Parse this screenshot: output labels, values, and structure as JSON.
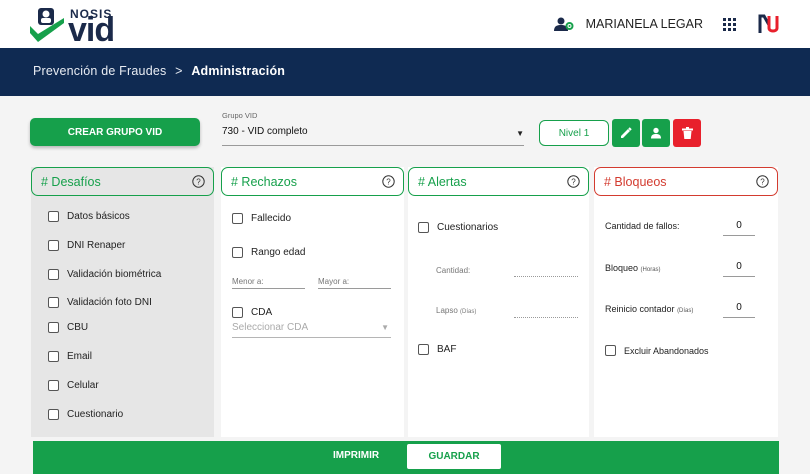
{
  "brand": {
    "small": "NOSIS",
    "large": "VID"
  },
  "user": {
    "name": "MARIANELA LEGAR"
  },
  "breadcrumb": {
    "parent": "Prevención de Fraudes",
    "separator": ">",
    "current": "Administración"
  },
  "controls": {
    "create_group_label": "CREAR GRUPO VID",
    "group_label": "Grupo VID",
    "group_value": "730 - VID completo",
    "level_label": "Nivel 1"
  },
  "panels": {
    "desafios": {
      "title": "# Desafíos",
      "items": [
        "Datos básicos",
        "DNI Renaper",
        "Validación biométrica",
        "Validación foto DNI",
        "CBU",
        "Email",
        "Celular",
        "Cuestionario"
      ]
    },
    "rechazos": {
      "title": "# Rechazos",
      "fallecido": "Fallecido",
      "rango_edad": "Rango edad",
      "menor_label": "Menor a:",
      "mayor_label": "Mayor a:",
      "cda": "CDA",
      "cda_placeholder": "Seleccionar CDA"
    },
    "alertas": {
      "title": "# Alertas",
      "cuestionarios": "Cuestionarios",
      "cantidad_label": "Cantidad:",
      "lapso_label": "Lapso",
      "lapso_unit": "(Días)",
      "baf": "BAF"
    },
    "bloqueos": {
      "title": "# Bloqueos",
      "fallos_label": "Cantidad de fallos:",
      "fallos_value": "0",
      "bloqueo_label": "Bloqueo",
      "bloqueo_unit": "(Horas)",
      "bloqueo_value": "0",
      "reinicio_label": "Reinicio contador",
      "reinicio_unit": "(Días)",
      "reinicio_value": "0",
      "excluir": "Excluir Abandonados"
    }
  },
  "footer": {
    "print_label": "IMPRIMIR",
    "save_label": "GUARDAR"
  },
  "colors": {
    "primary_green": "#16a04b",
    "navy": "#0f2a52",
    "danger_red": "#e8202c",
    "block_red": "#d33b2f"
  },
  "icons": [
    "nosis-logo-icon",
    "user-settings-icon",
    "apps-grid-icon",
    "nu-logo-icon",
    "help-circle-icon",
    "pencil-icon",
    "person-icon",
    "trash-icon",
    "dropdown-arrow-icon"
  ]
}
